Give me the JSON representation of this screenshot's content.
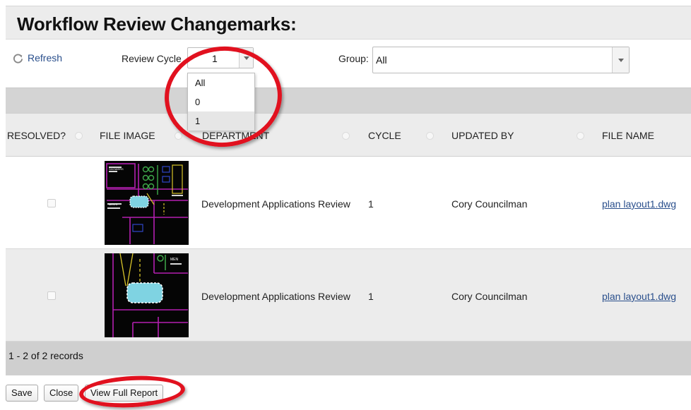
{
  "title": "Workflow Review Changemarks:",
  "toolbar": {
    "refresh_label": "Refresh",
    "review_cycle_label": "Review Cycle",
    "review_cycle_value": "1",
    "review_cycle_options": [
      "All",
      "0",
      "1"
    ],
    "group_label": "Group:",
    "group_value": "All"
  },
  "columns": [
    "RESOLVED?",
    "FILE IMAGE",
    "DEPARTMENT",
    "CYCLE",
    "UPDATED BY",
    "FILE NAME"
  ],
  "rows": [
    {
      "resolved": false,
      "department": "Development Applications Review",
      "cycle": "1",
      "updated_by": "Cory Councilman",
      "file_name": "plan layout1.dwg"
    },
    {
      "resolved": false,
      "department": "Development Applications Review",
      "cycle": "1",
      "updated_by": "Cory Councilman",
      "file_name": "plan layout1.dwg"
    }
  ],
  "footer": {
    "records": "1 - 2 of 2 records"
  },
  "buttons": {
    "save": "Save",
    "close": "Close",
    "view_full_report": "View Full Report"
  },
  "colors": {
    "highlight": "#e1111f",
    "link": "#2a4f8c",
    "thumb_bg": "#050505"
  }
}
